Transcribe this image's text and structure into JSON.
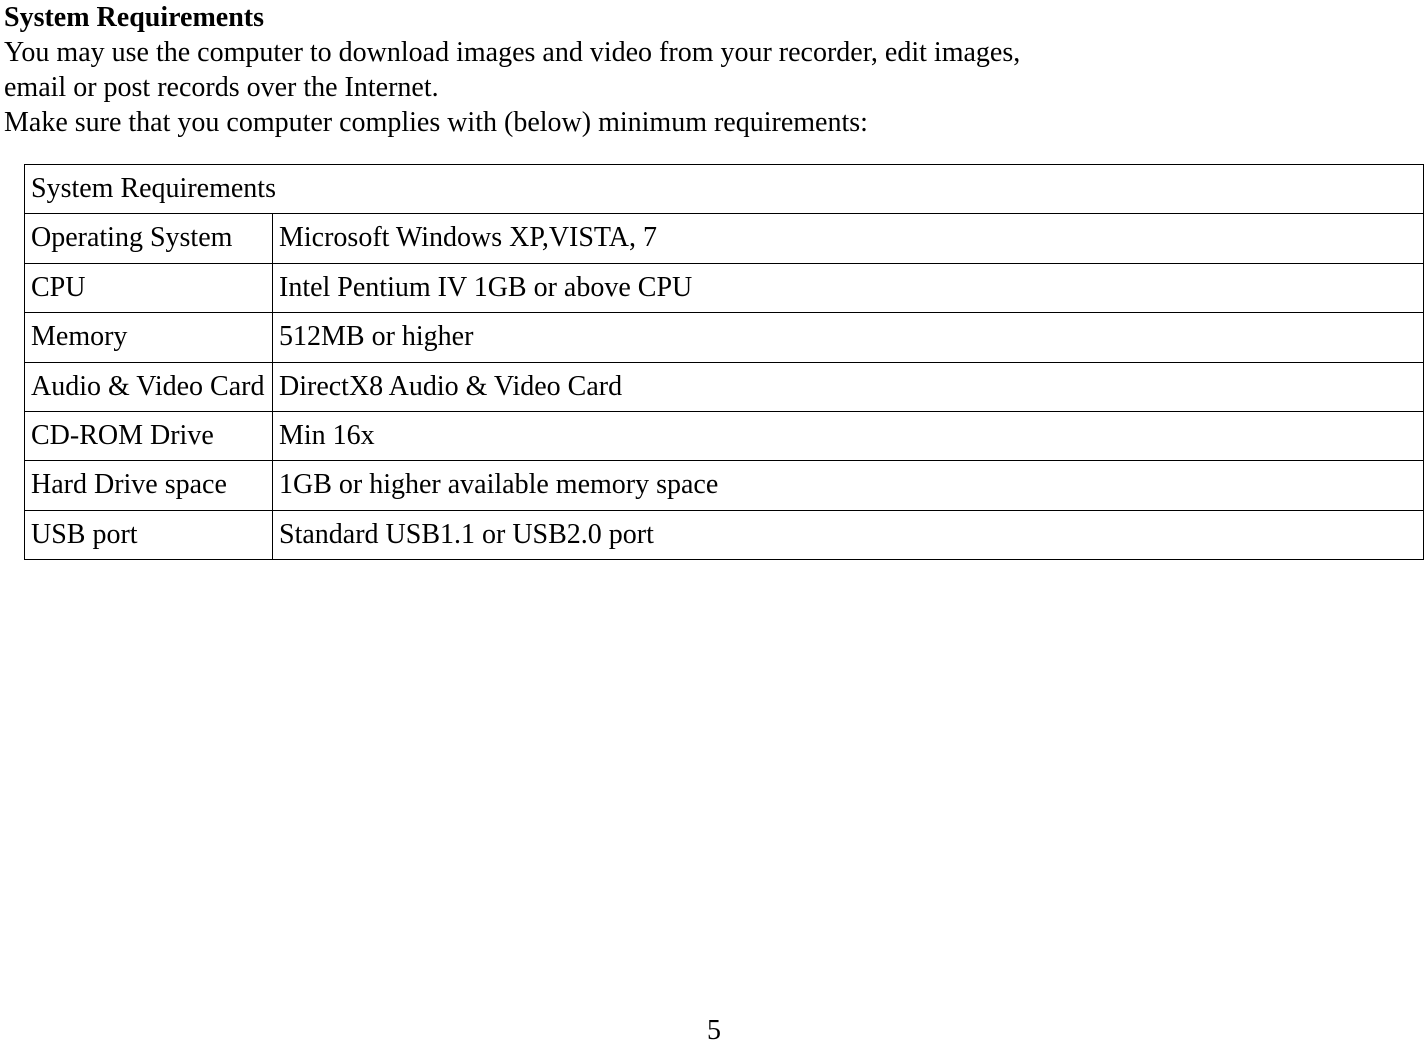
{
  "heading": "System Requirements",
  "intro_line1": "You may use the computer to download images and video from your recorder, edit images,",
  "intro_line2": "email or post records over the Internet.",
  "intro_line3": "Make sure that you computer complies with (below) minimum requirements:",
  "table": {
    "header": "System Requirements",
    "rows": [
      {
        "label": "Operating System",
        "value": "Microsoft Windows XP,VISTA, 7"
      },
      {
        "label": "CPU",
        "value": "Intel Pentium IV 1GB or above CPU"
      },
      {
        "label": "Memory",
        "value": "512MB or higher"
      },
      {
        "label": "Audio & Video Card",
        "value": "DirectX8 Audio & Video Card"
      },
      {
        "label": "CD-ROM Drive",
        "value": "Min 16x"
      },
      {
        "label": "Hard Drive space",
        "value": "1GB or higher available memory space"
      },
      {
        "label": "USB port",
        "value": "Standard USB1.1 or USB2.0 port"
      }
    ]
  },
  "page_number": "5"
}
